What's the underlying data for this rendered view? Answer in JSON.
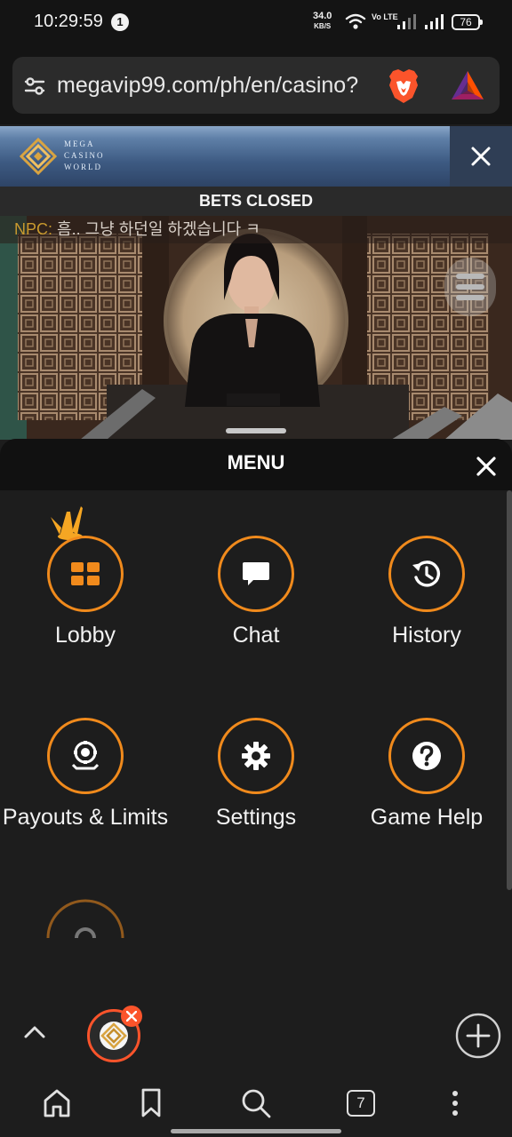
{
  "status_bar": {
    "time": "10:29:59",
    "notification_count": "1",
    "net_speed": "34.0",
    "net_speed_unit": "KB/S",
    "volte_label": "Vo LTE",
    "battery": "76"
  },
  "browser": {
    "url": "megavip99.com/ph/en/casino?",
    "tab_count": "7"
  },
  "casino_header": {
    "logo_text": [
      "MEGA",
      "CASINO",
      "WORLD"
    ]
  },
  "game": {
    "status": "BETS CLOSED",
    "chat_name": "NPC:",
    "chat_message": "흠.. 그냥 하던일 하겠습니다 ㅋ"
  },
  "menu": {
    "title": "MENU",
    "items": [
      {
        "label": "Lobby",
        "icon": "grid-icon"
      },
      {
        "label": "Chat",
        "icon": "chat-bubble-icon"
      },
      {
        "label": "History",
        "icon": "history-icon"
      },
      {
        "label": "Payouts & Limits",
        "icon": "chip-icon"
      },
      {
        "label": "Settings",
        "icon": "gear-icon"
      },
      {
        "label": "Game Help",
        "icon": "question-icon"
      }
    ]
  },
  "colors": {
    "accent": "#f08a1c",
    "crown": "#f5a623",
    "menu_bg": "#1d1d1d"
  }
}
